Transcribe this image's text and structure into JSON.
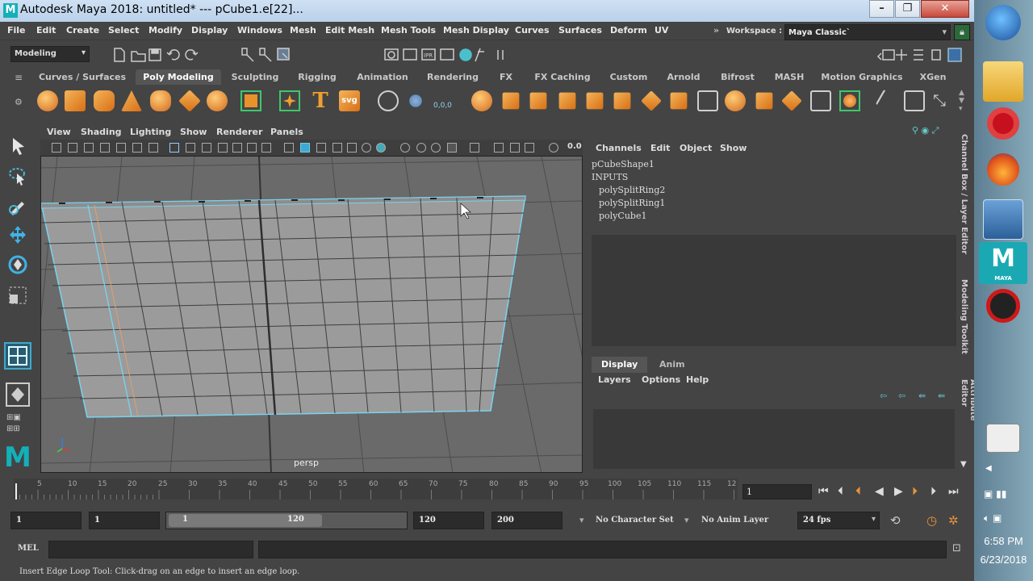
{
  "window": {
    "title": "Autodesk Maya 2018: untitled*   ---   pCube1.e[22]...",
    "logo": "M",
    "min": "–",
    "max": "❐",
    "close": "✕"
  },
  "menu": [
    "File",
    "Edit",
    "Create",
    "Select",
    "Modify",
    "Display",
    "Windows",
    "Mesh",
    "Edit Mesh",
    "Mesh Tools",
    "Mesh Display",
    "Curves",
    "Surfaces",
    "Deform",
    "UV"
  ],
  "workspace": {
    "label": "Workspace :",
    "value": "Maya Classic`"
  },
  "mode_dropdown": "Modeling",
  "shelf_tabs": [
    "Curves / Surfaces",
    "Poly Modeling",
    "Sculpting",
    "Rigging",
    "Animation",
    "Rendering",
    "FX",
    "FX Caching",
    "Custom",
    "Arnold",
    "Bifrost",
    "MASH",
    "Motion Graphics",
    "XGen"
  ],
  "shelf_active": "Poly Modeling",
  "shelf_text_icon": "T",
  "shelf_svg_icon": "svg",
  "shelf_counter": "0,0,0",
  "viewport": {
    "menu": [
      "View",
      "Shading",
      "Lighting",
      "Show",
      "Renderer",
      "Panels"
    ],
    "value": "0.0",
    "camera_label": "persp"
  },
  "channel_box": {
    "menu": [
      "Channels",
      "Edit",
      "Object",
      "Show"
    ],
    "shape": "pCubeShape1",
    "inputs_label": "INPUTS",
    "inputs": [
      "polySplitRing2",
      "polySplitRing1",
      "polyCube1"
    ]
  },
  "layer_panel": {
    "tabs": [
      "Display",
      "Anim"
    ],
    "menu": [
      "Layers",
      "Options",
      "Help"
    ]
  },
  "side_labels": [
    "Channel Box / Layer Editor",
    "Modeling Toolkit",
    "Attribute Editor"
  ],
  "timeline": {
    "ticks": [
      "5",
      "10",
      "15",
      "20",
      "25",
      "30",
      "35",
      "40",
      "45",
      "50",
      "55",
      "60",
      "65",
      "70",
      "75",
      "80",
      "85",
      "90",
      "95",
      "100",
      "105",
      "110",
      "115",
      "12"
    ],
    "current_frame": "1"
  },
  "range": {
    "start": "1",
    "inner_start": "1",
    "slider_start": "1",
    "slider_end": "120",
    "end": "120",
    "anim_end": "200",
    "character_set": "No Character Set",
    "anim_layer": "No Anim Layer",
    "fps": "24 fps"
  },
  "command": {
    "label": "MEL"
  },
  "help_text": "Insert Edge Loop Tool: Click-drag on an edge to insert an edge loop.",
  "taskbar": {
    "time": "6:58 PM",
    "date": "6/23/2018",
    "maya_label": "MAYA"
  }
}
